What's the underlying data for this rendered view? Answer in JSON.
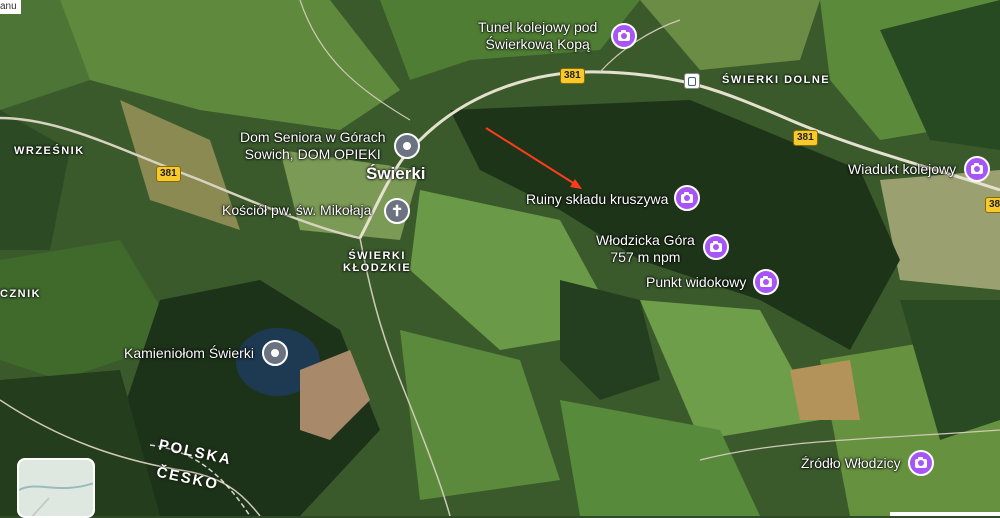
{
  "top_left_text": "anu",
  "places": [
    {
      "id": "tunel",
      "label_line1": "Tunel kolejowy pod",
      "label_line2": "Świerkową Kopą",
      "icon": "camera-icon"
    },
    {
      "id": "dom",
      "label_line1": "Dom Seniora w Górach",
      "label_line2": "Sowich, DOM OPIEKI",
      "icon": "place-icon"
    },
    {
      "id": "kosciol",
      "label_line1": "Kościół pw. św. Mikołaja",
      "icon": "church-icon"
    },
    {
      "id": "kamieniolom",
      "label_line1": "Kamieniołom Świerki",
      "icon": "place-icon"
    },
    {
      "id": "ruiny",
      "label_line1": "Ruiny składu kruszywa",
      "icon": "camera-icon"
    },
    {
      "id": "wlodzicka",
      "label_line1": "Włodzicka Góra",
      "label_line2": "757 m npm",
      "icon": "camera-icon"
    },
    {
      "id": "punkt",
      "label_line1": "Punkt widokowy",
      "icon": "camera-icon"
    },
    {
      "id": "wiadukt",
      "label_line1": "Wiadukt kolejowy",
      "icon": "camera-icon"
    },
    {
      "id": "zrodlo",
      "label_line1": "Źródło Włodzicy",
      "icon": "camera-icon"
    }
  ],
  "localities": {
    "swierki": "Świerki",
    "swierki_dolne": "ŚWIERKI DOLNE",
    "swierki_klodzkie_1": "ŚWIERKI",
    "swierki_klodzkie_2": "KŁODZKIE",
    "wrzesnik": "WRZEŚNIK",
    "lcznik": "CZNIK"
  },
  "countries": {
    "poland": "POLSKA",
    "czechia": "ČESKO"
  },
  "roads": {
    "shield_1": "381",
    "shield_2": "381",
    "shield_3": "381",
    "shield_4": "38"
  },
  "colors": {
    "poi_purple": "#a855f7",
    "road_shield": "#f8c92c",
    "arrow": "#ff3b1f"
  }
}
